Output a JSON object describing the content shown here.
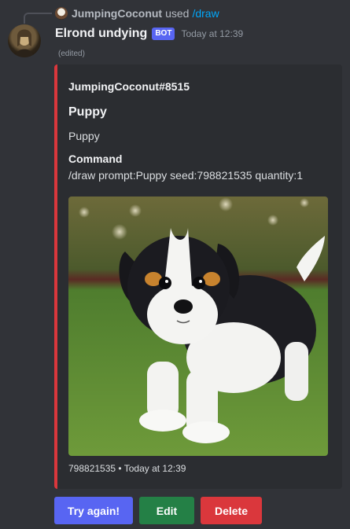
{
  "reply": {
    "username": "JumpingCoconut",
    "used_text": "used",
    "command": "/draw"
  },
  "message": {
    "bot_name": "Elrond undying",
    "badge": "BOT",
    "timestamp": "Today at 12:39",
    "edited": "(edited)"
  },
  "embed": {
    "accent_color": "#da373c",
    "author": "JumpingCoconut#8515",
    "title": "Puppy",
    "description": "Puppy",
    "field_name": "Command",
    "field_value": "/draw prompt:Puppy seed:798821535 quantity:1",
    "footer": "798821535 • Today at 12:39"
  },
  "buttons": {
    "try_again": "Try again!",
    "edit": "Edit",
    "delete": "Delete"
  },
  "colors": {
    "blurple": "#5865f2",
    "green": "#248046",
    "red": "#da373c",
    "link": "#00a8fc"
  }
}
